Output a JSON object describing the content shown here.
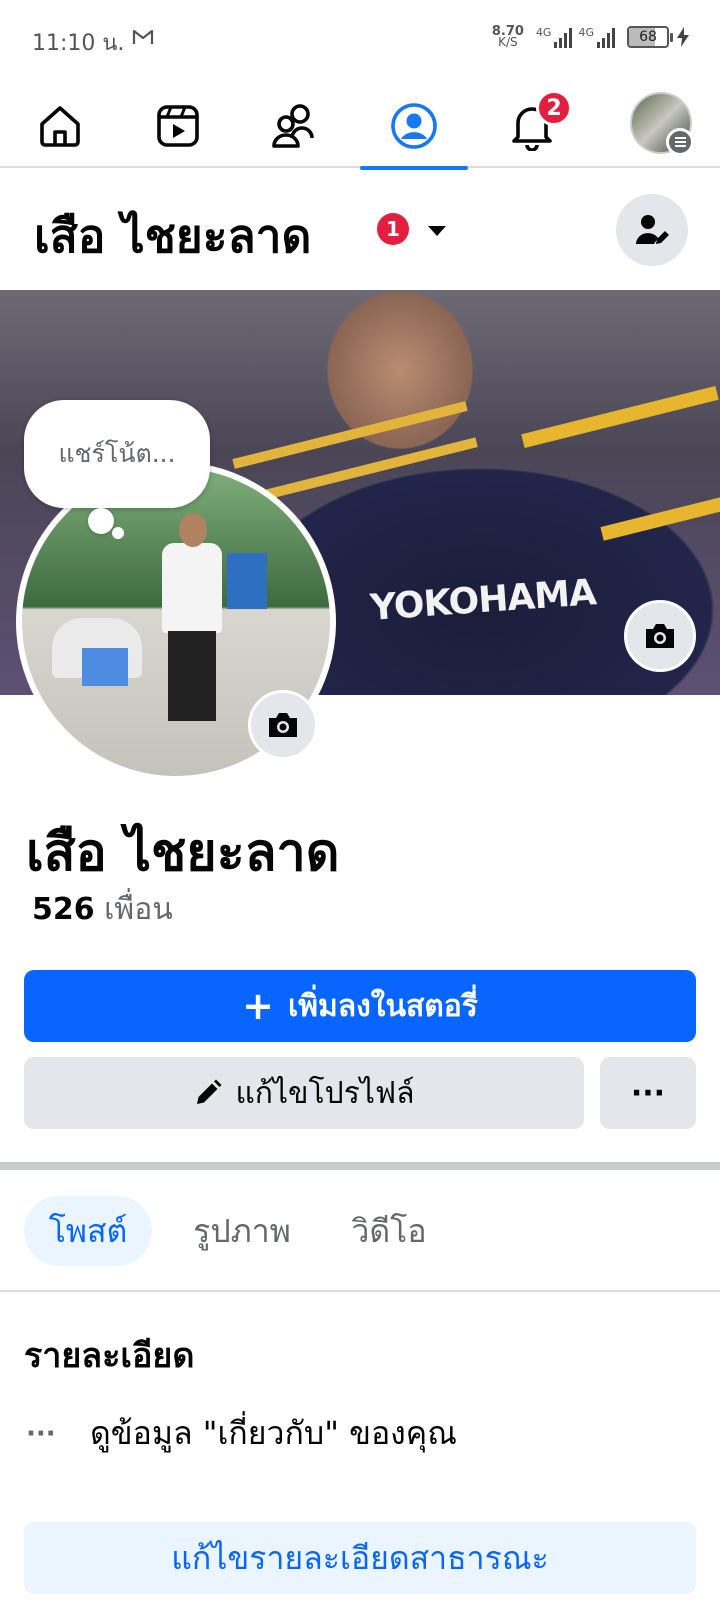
{
  "status_bar": {
    "time": "11:10 น.",
    "net_speed_value": "8.70",
    "net_speed_unit": "K/S",
    "signal1_label": "4G",
    "signal2_label": "4G",
    "battery_level": "68"
  },
  "topnav": {
    "items": [
      "home",
      "watch",
      "friends",
      "profile",
      "notifications",
      "menu"
    ],
    "active": "profile",
    "notifications_badge": "2"
  },
  "header": {
    "name": "เสือ ไชยะลาด",
    "badge": "1"
  },
  "profile": {
    "note_placeholder": "แชร์โน้ต...",
    "cover_text": "YOKOHAMA",
    "name": "เสือ ไชยะลาด",
    "friends_count": "526",
    "friends_label": "เพื่อน"
  },
  "actions": {
    "add_story_icon": "+",
    "add_story_label": "เพิ่มลงในสตอรี่",
    "edit_profile_label": "แก้ไขโปรไฟล์",
    "more_label": "···"
  },
  "tabs": [
    {
      "label": "โพสต์",
      "active": true
    },
    {
      "label": "รูปภาพ",
      "active": false
    },
    {
      "label": "วิดีโอ",
      "active": false
    }
  ],
  "details": {
    "title": "รายละเอียด",
    "row_icon": "···",
    "row_text": "ดูข้อมูล \"เกี่ยวกับ\" ของคุณ",
    "edit_button_label": "แก้ไขรายละเอียดสาธารณะ"
  },
  "colors": {
    "accent": "#0866ff",
    "badge": "#e41e3f",
    "secondary_button": "#e4e6eb"
  }
}
